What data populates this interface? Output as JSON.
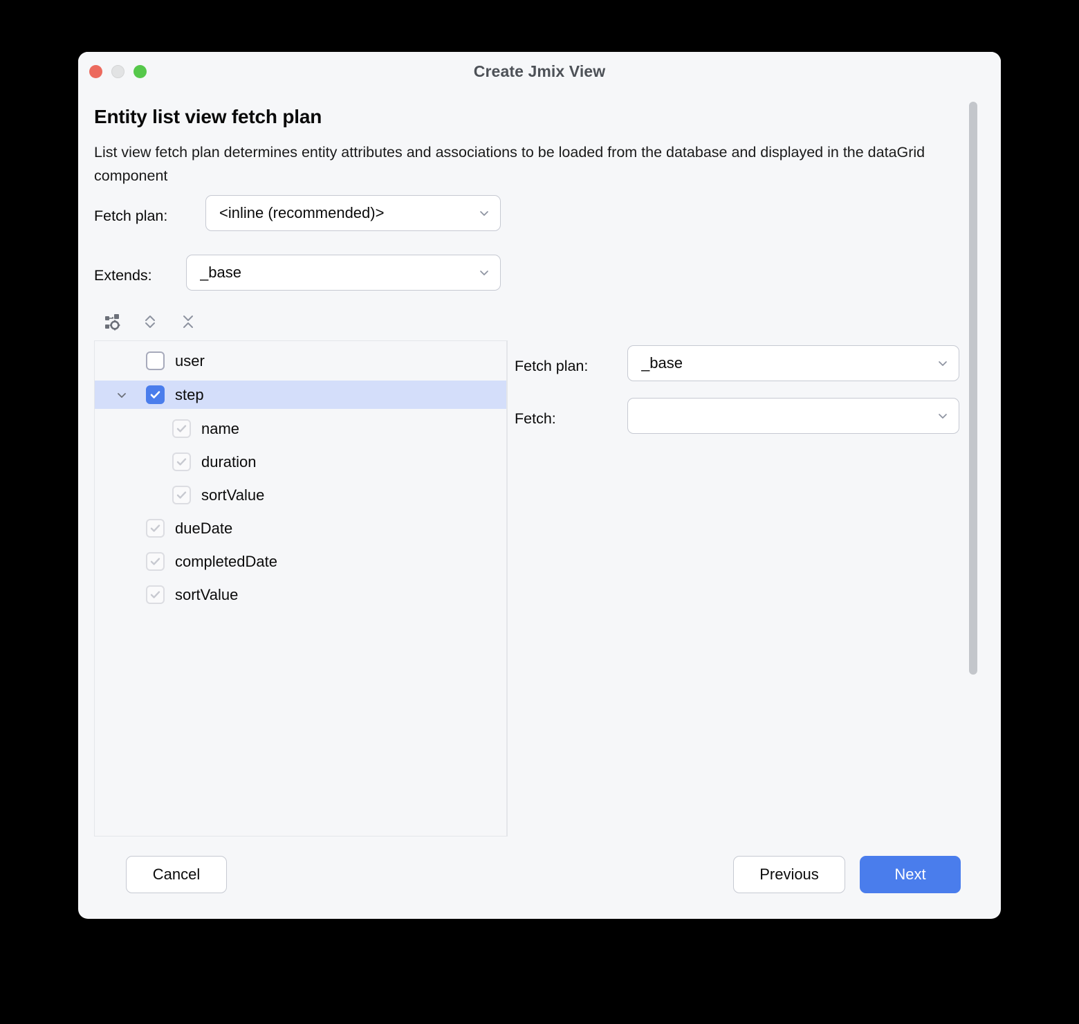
{
  "window": {
    "title": "Create Jmix View",
    "traffic_lights": [
      {
        "name": "close",
        "color": "#EC6A5E"
      },
      {
        "name": "minimize",
        "color": "#E2E3E4"
      },
      {
        "name": "maximize",
        "color": "#56C84B"
      }
    ]
  },
  "page": {
    "heading": "Entity list view fetch plan",
    "description": "List view fetch plan determines entity attributes and associations to be loaded from the database and displayed in the dataGrid component"
  },
  "form": {
    "fetch_plan_label": "Fetch plan:",
    "fetch_plan_value": "<inline (recommended)>",
    "extends_label": "Extends:",
    "extends_value": "_base"
  },
  "toolbar": {
    "items": [
      {
        "name": "configure-structure-icon",
        "tooltip": "Configure"
      },
      {
        "name": "expand-all-icon",
        "tooltip": "Expand All"
      },
      {
        "name": "collapse-all-icon",
        "tooltip": "Collapse All"
      }
    ]
  },
  "tree": {
    "nodes": [
      {
        "label": "user",
        "level": 0,
        "checkbox": "unchecked",
        "twisty": false,
        "selected": false
      },
      {
        "label": "step",
        "level": 0,
        "checkbox": "checked",
        "twisty": true,
        "selected": true
      },
      {
        "label": "name",
        "level": 1,
        "checkbox": "disabled-checked",
        "twisty": false,
        "selected": false
      },
      {
        "label": "duration",
        "level": 1,
        "checkbox": "disabled-checked",
        "twisty": false,
        "selected": false
      },
      {
        "label": "sortValue",
        "level": 1,
        "checkbox": "disabled-checked",
        "twisty": false,
        "selected": false
      },
      {
        "label": "dueDate",
        "level": 0,
        "checkbox": "disabled-checked",
        "twisty": false,
        "selected": false
      },
      {
        "label": "completedDate",
        "level": 0,
        "checkbox": "disabled-checked",
        "twisty": false,
        "selected": false
      },
      {
        "label": "sortValue",
        "level": 0,
        "checkbox": "disabled-checked",
        "twisty": false,
        "selected": false
      }
    ]
  },
  "detail": {
    "fetch_plan_label": "Fetch plan:",
    "fetch_plan_value": "_base",
    "fetch_label": "Fetch:",
    "fetch_value": ""
  },
  "footer": {
    "cancel_label": "Cancel",
    "previous_label": "Previous",
    "next_label": "Next"
  },
  "colors": {
    "accent": "#4A7DEC",
    "selection": "#D4DEFA",
    "dialog_bg": "#F6F7F9",
    "border": "#C6C9D2"
  }
}
